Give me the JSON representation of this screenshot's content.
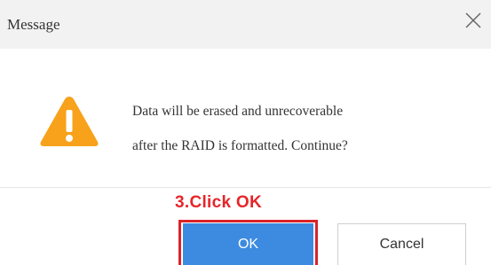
{
  "dialog": {
    "title": "Message",
    "close_icon": "close-icon",
    "warning_icon": "warning-triangle-icon",
    "message_line1": "Data will be erased and unrecoverable",
    "message_line2": "after the RAID is formatted. Continue?"
  },
  "annotation": {
    "text": "3.Click OK",
    "color": "#e5262b"
  },
  "buttons": {
    "ok_label": "OK",
    "cancel_label": "Cancel"
  },
  "colors": {
    "ok_button": "#3d8be0",
    "warning_icon": "#f7a21a",
    "titlebar": "#f2f2f2"
  }
}
